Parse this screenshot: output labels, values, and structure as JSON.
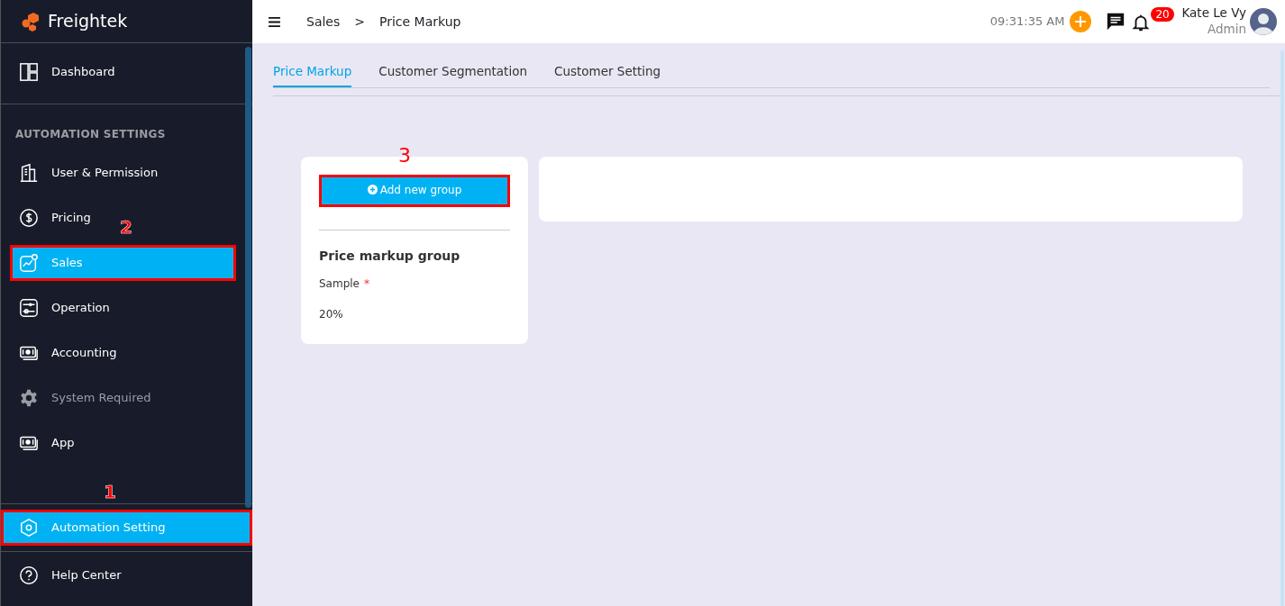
{
  "brand": "Freightek",
  "header": {
    "breadcrumb": [
      "Sales",
      "Price Markup"
    ],
    "separator": ">",
    "time": "09:31:35 AM",
    "notification_count": "20",
    "user_name": "Kate Le Vy",
    "user_role": "Admin"
  },
  "sidebar": {
    "top_items": [
      {
        "label": "Dashboard",
        "kind": "dashboard",
        "selected": false,
        "disabled": false
      }
    ],
    "section_title": "AUTOMATION SETTINGS",
    "items": [
      {
        "label": "User & Permission",
        "kind": "building",
        "selected": false,
        "disabled": false
      },
      {
        "label": "Pricing",
        "kind": "dollar",
        "selected": false,
        "disabled": false
      },
      {
        "label": "Sales",
        "kind": "chart",
        "selected": true,
        "disabled": false,
        "callout": "2"
      },
      {
        "label": "Operation",
        "kind": "sliders",
        "selected": false,
        "disabled": false
      },
      {
        "label": "Accounting",
        "kind": "money",
        "selected": false,
        "disabled": false
      },
      {
        "label": "System Required",
        "kind": "gear",
        "selected": false,
        "disabled": true
      },
      {
        "label": "App",
        "kind": "money",
        "selected": false,
        "disabled": false
      }
    ],
    "bottom_items": [
      {
        "label": "Automation Setting",
        "kind": "hexagon",
        "selected": true,
        "disabled": false,
        "callout": "1"
      },
      {
        "label": "Help Center",
        "kind": "help",
        "selected": false,
        "disabled": false
      }
    ]
  },
  "tabs": [
    {
      "label": "Price Markup",
      "selected": true
    },
    {
      "label": "Customer Segmentation",
      "selected": false
    },
    {
      "label": "Customer Setting",
      "selected": false
    }
  ],
  "group_panel": {
    "add_button": "Add new group",
    "add_callout": "3",
    "title": "Price markup group",
    "field_label": "Sample",
    "required_mark": "*",
    "field_value": "20%"
  }
}
